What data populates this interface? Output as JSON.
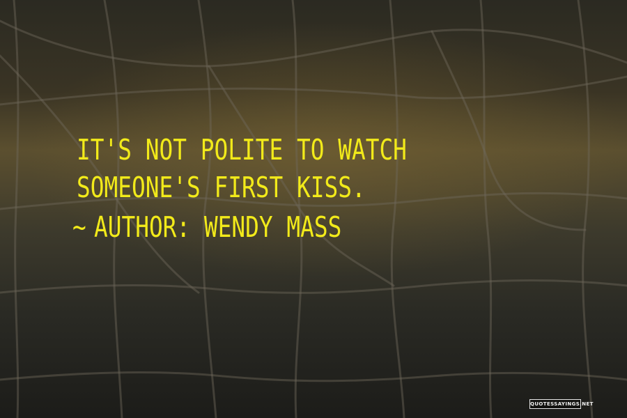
{
  "quote": {
    "text": "IT'S NOT POLITE TO WATCH SOMEONE'S FIRST KISS."
  },
  "author": {
    "prefix": "~",
    "label": "AUTHOR: WENDY MASS"
  },
  "watermark": {
    "text": "QUOTESSAYINGS.NET"
  },
  "colors": {
    "quote_text": "#f2ea1a",
    "background_dark": "#1e1c16",
    "net": "#6e685a"
  }
}
